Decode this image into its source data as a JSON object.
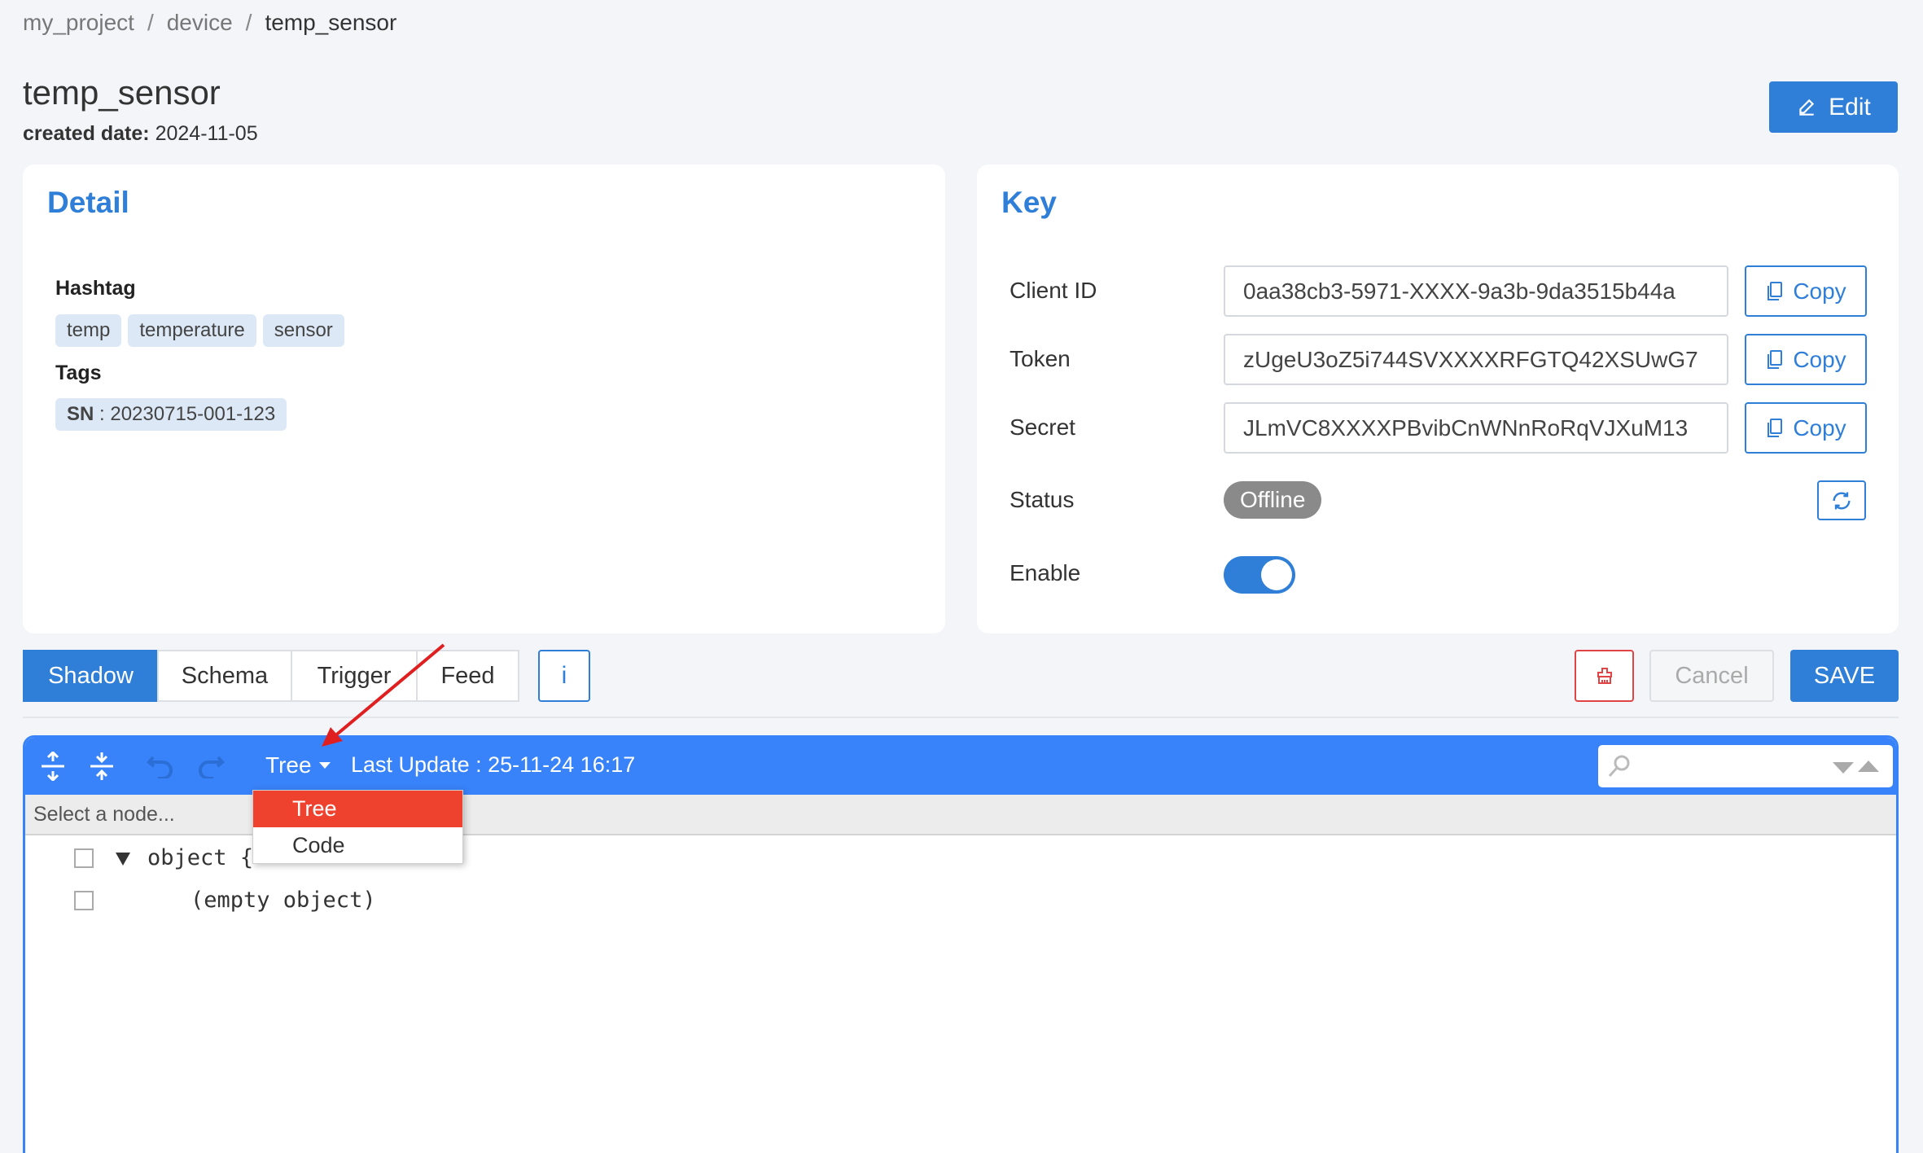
{
  "breadcrumb": {
    "items": [
      "my_project",
      "device",
      "temp_sensor"
    ],
    "separator": "/"
  },
  "page": {
    "title": "temp_sensor",
    "created_label": "created date:",
    "created_value": "2024-11-05"
  },
  "header": {
    "edit_label": "Edit",
    "edit_icon": "pencil-icon"
  },
  "detail": {
    "title": "Detail",
    "hashtag_label": "Hashtag",
    "hashtags": [
      "temp",
      "temperature",
      "sensor"
    ],
    "tags_label": "Tags",
    "tags": [
      {
        "key": "SN",
        "sep": " : ",
        "value": "20230715-001-123"
      }
    ]
  },
  "key": {
    "title": "Key",
    "client_id_label": "Client ID",
    "client_id_value": "0aa38cb3-5971-XXXX-9a3b-9da3515b44a",
    "token_label": "Token",
    "token_value": "zUgeU3oZ5i744SVXXXXRFGTQ42XSUwG7",
    "secret_label": "Secret",
    "secret_value": "JLmVC8XXXXPBvibCnWNnRoRqVJXuM13",
    "copy_label": "Copy",
    "status_label": "Status",
    "status_value": "Offline",
    "enable_label": "Enable",
    "enable_on": true
  },
  "tabs": [
    {
      "label": "Shadow",
      "active": true
    },
    {
      "label": "Schema",
      "active": false
    },
    {
      "label": "Trigger",
      "active": false
    },
    {
      "label": "Feed",
      "active": false
    }
  ],
  "actions": {
    "info_label": "i",
    "cancel_label": "Cancel",
    "save_label": "SAVE"
  },
  "editor": {
    "mode_label": "Tree",
    "last_update": "Last Update : 25-11-24 16:17",
    "nav_placeholder": "Select a node...",
    "root_label": "object",
    "root_brace": "{",
    "empty_label": "(empty object)",
    "mode_options": [
      {
        "label": "Tree",
        "selected": true
      },
      {
        "label": "Code",
        "selected": false
      }
    ]
  },
  "colors": {
    "primary": "#2f7fd8",
    "editor_blue": "#3883fa",
    "danger": "#ee422e",
    "status_gray": "#8a8a8a"
  }
}
